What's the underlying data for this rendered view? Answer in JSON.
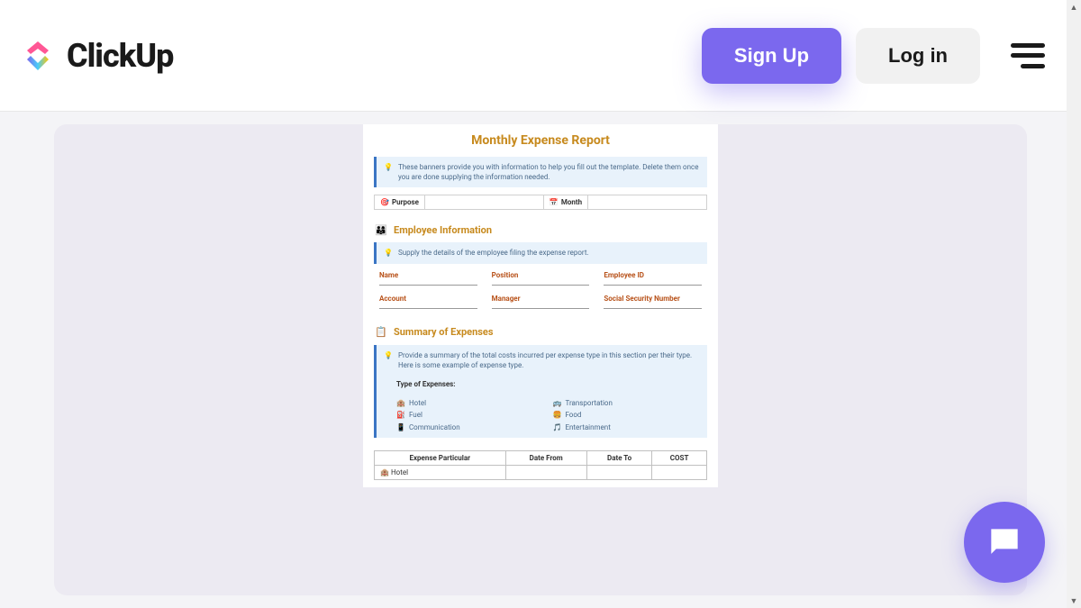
{
  "header": {
    "logo_text": "ClickUp",
    "signup_label": "Sign Up",
    "login_label": "Log in"
  },
  "template": {
    "title": "Monthly Expense Report",
    "banner1": "These banners provide you with information to help you fill out the template. Delete them once you are done supplying the information needed.",
    "purpose_label": "Purpose",
    "month_label": "Month",
    "emp_section": "Employee Information",
    "banner2": "Supply the details of the employee filing the expense report.",
    "emp_fields": {
      "name": "Name",
      "position": "Position",
      "employee_id": "Employee ID",
      "account": "Account",
      "manager": "Manager",
      "ssn": "Social Security Number"
    },
    "summary_section": "Summary of Expenses",
    "banner3": "Provide a summary of the total costs incurred per expense type in this section per their type. Here is some example of expense type.",
    "type_label": "Type of Expenses:",
    "types": {
      "hotel": "Hotel",
      "transportation": "Transportation",
      "fuel": "Fuel",
      "food": "Food",
      "communication": "Communication",
      "entertainment": "Entertainment"
    },
    "table": {
      "h1": "Expense Particular",
      "h2": "Date From",
      "h3": "Date To",
      "h4": "COST",
      "r1c1": "Hotel"
    }
  }
}
